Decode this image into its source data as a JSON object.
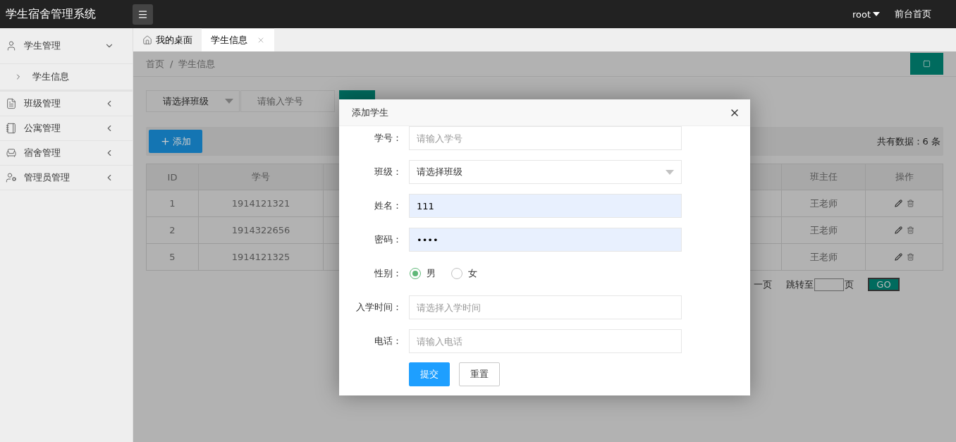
{
  "topbar": {
    "title": "学生宿舍管理系统",
    "user": "root",
    "home_link": "前台首页"
  },
  "sidebar": [
    {
      "kind": "student",
      "label": "学生管理",
      "expanded": true,
      "children": [
        {
          "label": "学生信息"
        }
      ]
    },
    {
      "kind": "class",
      "label": "班级管理",
      "expanded": false
    },
    {
      "kind": "apartment",
      "label": "公寓管理",
      "expanded": false
    },
    {
      "kind": "dorm",
      "label": "宿舍管理",
      "expanded": false
    },
    {
      "kind": "admin",
      "label": "管理员管理",
      "expanded": false
    }
  ],
  "tabs": [
    {
      "kind": "home",
      "label": "我的桌面",
      "selected": false,
      "closable": false
    },
    {
      "kind": "page",
      "label": "学生信息",
      "selected": true,
      "closable": true
    }
  ],
  "breadcrumb": [
    "首页",
    "学生信息"
  ],
  "breadcrumb_separator": "/",
  "filters": {
    "class_select": "请选择班级",
    "id_placeholder": "请输入学号"
  },
  "toolbar": {
    "add_button": "添加",
    "total": "共有数据：6 条"
  },
  "table": {
    "columns": [
      "ID",
      "学号",
      "班主任",
      "操作"
    ],
    "rows": [
      {
        "id": "1",
        "number": "1914121321",
        "teacher": "王老师"
      },
      {
        "id": "2",
        "number": "1914322656",
        "teacher": "王老师"
      },
      {
        "id": "5",
        "number": "1914121325",
        "teacher": "王老师"
      }
    ]
  },
  "pagination": {
    "prev_fragment": "一页",
    "jump_label": "跳转至",
    "page_unit": "页",
    "go": "GO"
  },
  "dialog": {
    "title": "添加学生",
    "fields": [
      {
        "kind": "text",
        "label": "学号：",
        "placeholder": "请输入学号"
      },
      {
        "kind": "select",
        "label": "班级：",
        "value": "请选择班级"
      },
      {
        "kind": "text",
        "label": "姓名：",
        "value": "111",
        "autofilled": true
      },
      {
        "kind": "text",
        "label": "密码：",
        "value": "••••",
        "autofilled": true
      },
      {
        "kind": "radio",
        "label": "性别：",
        "options": [
          {
            "label": "男",
            "selected": true
          },
          {
            "label": "女",
            "selected": false
          }
        ]
      },
      {
        "kind": "text",
        "label": "入学时间：",
        "placeholder": "请选择入学时间"
      },
      {
        "kind": "text",
        "label": "电话：",
        "placeholder": "请输入电话"
      }
    ],
    "buttons": [
      {
        "kind": "primary",
        "label": "提交"
      },
      {
        "kind": "default",
        "label": "重置"
      }
    ]
  }
}
